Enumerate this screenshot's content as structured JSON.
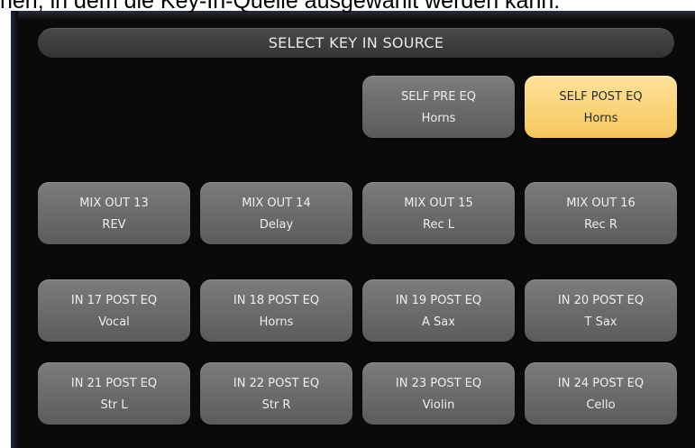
{
  "caption": "hen, in dem die Key-In-Quelle ausgewählt werden kann.",
  "dialog": {
    "title": "SELECT KEY IN SOURCE"
  },
  "buttons": {
    "self_pre_eq": {
      "line1": "SELF PRE EQ",
      "line2": "Horns",
      "selected": false
    },
    "self_post_eq": {
      "line1": "SELF POST EQ",
      "line2": "Horns",
      "selected": true
    },
    "mix_out_13": {
      "line1": "MIX OUT 13",
      "line2": "REV"
    },
    "mix_out_14": {
      "line1": "MIX OUT 14",
      "line2": "Delay"
    },
    "mix_out_15": {
      "line1": "MIX OUT 15",
      "line2": "Rec L"
    },
    "mix_out_16": {
      "line1": "MIX OUT 16",
      "line2": "Rec R"
    },
    "in_17": {
      "line1": "IN 17 POST EQ",
      "line2": "Vocal"
    },
    "in_18": {
      "line1": "IN 18 POST EQ",
      "line2": "Horns"
    },
    "in_19": {
      "line1": "IN 19 POST EQ",
      "line2": "A Sax"
    },
    "in_20": {
      "line1": "IN 20 POST EQ",
      "line2": "T Sax"
    },
    "in_21": {
      "line1": "IN 21 POST EQ",
      "line2": "Str L"
    },
    "in_22": {
      "line1": "IN 22 POST EQ",
      "line2": "Str R"
    },
    "in_23": {
      "line1": "IN 23 POST EQ",
      "line2": "Violin"
    },
    "in_24": {
      "line1": "IN 24 POST EQ",
      "line2": "Cello"
    }
  },
  "colors": {
    "selected_accent": "#f6c65c",
    "button_gray": "#6a6a6a",
    "background": "#0a0a0a"
  }
}
